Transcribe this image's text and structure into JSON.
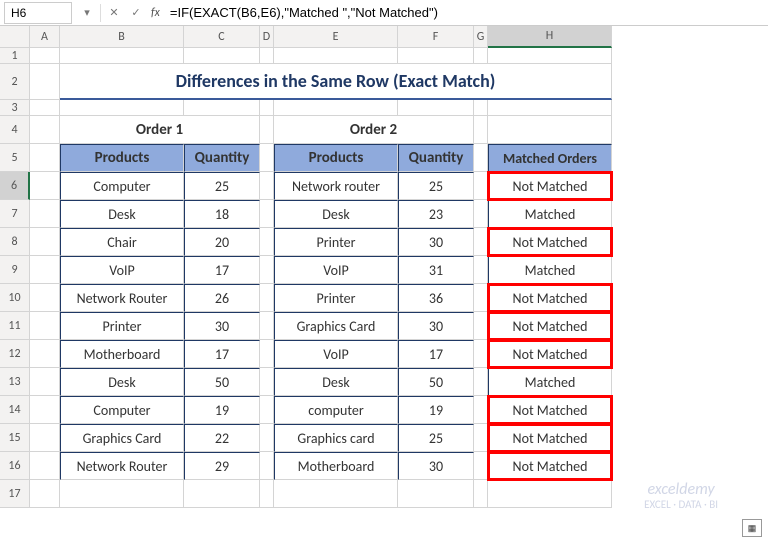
{
  "nameBox": "H6",
  "formula": "=IF(EXACT(B6,E6),\"Matched \",\"Not Matched\")",
  "cols": [
    "",
    "A",
    "B",
    "C",
    "D",
    "E",
    "F",
    "G",
    "H"
  ],
  "title": "Differences in the Same Row (Exact Match)",
  "sec1": "Order 1",
  "sec2": "Order 2",
  "h": {
    "prod": "Products",
    "qty": "Quantity",
    "match": "Matched Orders"
  },
  "rows": [
    {
      "r": 6,
      "p1": "Computer",
      "q1": "25",
      "p2": "Network router",
      "q2": "25",
      "m": "Not Matched",
      "hl": true,
      "active": true
    },
    {
      "r": 7,
      "p1": "Desk",
      "q1": "18",
      "p2": "Desk",
      "q2": "23",
      "m": "Matched",
      "hl": false
    },
    {
      "r": 8,
      "p1": "Chair",
      "q1": "20",
      "p2": "Printer",
      "q2": "30",
      "m": "Not Matched",
      "hl": true
    },
    {
      "r": 9,
      "p1": "VoIP",
      "q1": "17",
      "p2": "VoIP",
      "q2": "31",
      "m": "Matched",
      "hl": false
    },
    {
      "r": 10,
      "p1": "Network Router",
      "q1": "26",
      "p2": "Printer",
      "q2": "36",
      "m": "Not Matched",
      "hl": true
    },
    {
      "r": 11,
      "p1": "Printer",
      "q1": "30",
      "p2": "Graphics Card",
      "q2": "30",
      "m": "Not Matched",
      "hl": true
    },
    {
      "r": 12,
      "p1": "Motherboard",
      "q1": "17",
      "p2": "VoIP",
      "q2": "17",
      "m": "Not Matched",
      "hl": true
    },
    {
      "r": 13,
      "p1": "Desk",
      "q1": "50",
      "p2": "Desk",
      "q2": "50",
      "m": "Matched",
      "hl": false
    },
    {
      "r": 14,
      "p1": "Computer",
      "q1": "19",
      "p2": "computer",
      "q2": "19",
      "m": "Not Matched",
      "hl": true
    },
    {
      "r": 15,
      "p1": "Graphics Card",
      "q1": "22",
      "p2": "Graphics card",
      "q2": "25",
      "m": "Not Matched",
      "hl": true
    },
    {
      "r": 16,
      "p1": "Network Router",
      "q1": "29",
      "p2": "Motherboard",
      "q2": "30",
      "m": "Not Matched",
      "hl": true
    }
  ],
  "wm": "exceldemy",
  "wm2": "EXCEL · DATA · BI",
  "fillIcon": "▦"
}
